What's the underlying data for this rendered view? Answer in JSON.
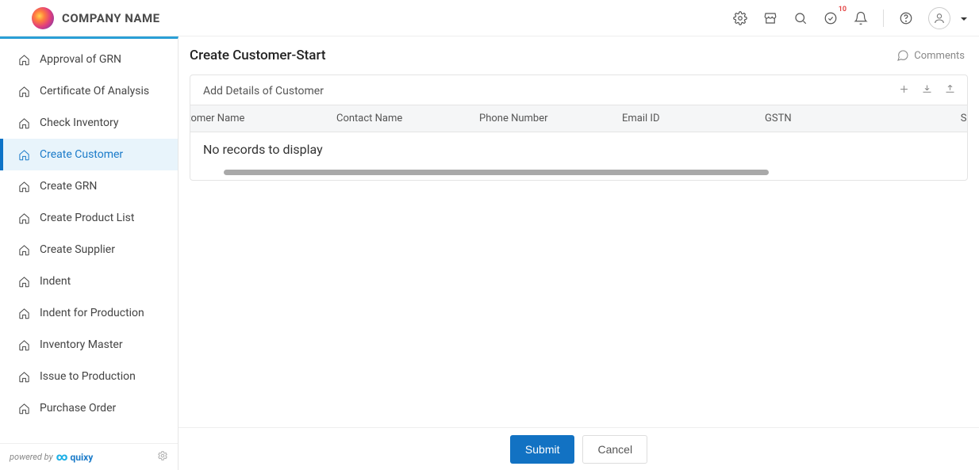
{
  "header": {
    "company_name": "COMPANY NAME",
    "notification_badge": "10"
  },
  "sidebar": {
    "items": [
      {
        "label": "Approval of GRN",
        "active": false
      },
      {
        "label": "Certificate Of Analysis",
        "active": false
      },
      {
        "label": "Check Inventory",
        "active": false
      },
      {
        "label": "Create Customer",
        "active": true
      },
      {
        "label": "Create GRN",
        "active": false
      },
      {
        "label": "Create Product List",
        "active": false
      },
      {
        "label": "Create Supplier",
        "active": false
      },
      {
        "label": "Indent",
        "active": false
      },
      {
        "label": "Indent for Production",
        "active": false
      },
      {
        "label": "Inventory Master",
        "active": false
      },
      {
        "label": "Issue to Production",
        "active": false
      },
      {
        "label": "Purchase Order",
        "active": false
      }
    ],
    "powered_by_label": "powered by",
    "brand": "quixy"
  },
  "page": {
    "title": "Create Customer-Start",
    "comments_label": "Comments"
  },
  "panel": {
    "title": "Add Details of Customer",
    "columns": {
      "customer_name": "Customer Name",
      "contact_name": "Contact Name",
      "phone_number": "Phone Number",
      "email_id": "Email ID",
      "gstn": "GSTN",
      "shipping_address": "Shipping Address"
    },
    "no_records_text": "No records to display",
    "rows": []
  },
  "footer": {
    "submit_label": "Submit",
    "cancel_label": "Cancel"
  },
  "colors": {
    "accent": "#1272c3",
    "sidebar_active_bg": "#e8f4fb",
    "sidebar_border_top": "#2a9fd6"
  }
}
